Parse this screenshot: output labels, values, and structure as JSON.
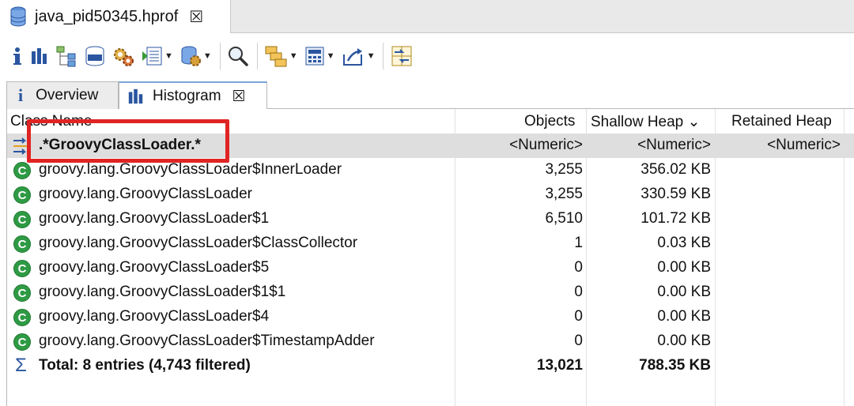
{
  "editor_tab": {
    "title": "java_pid50345.hprof",
    "close": "☒"
  },
  "inner_tabs": [
    {
      "label": "Overview"
    },
    {
      "label": "Histogram",
      "close": "☒"
    }
  ],
  "table": {
    "columns": {
      "class_name": "Class Name",
      "objects": "Objects",
      "shallow_heap": "Shallow Heap",
      "shallow_sort": "⌄",
      "retained_heap": "Retained Heap"
    },
    "filter": {
      "class_name": ".*GroovyClassLoader.*",
      "objects": "<Numeric>",
      "shallow_heap": "<Numeric>",
      "retained_heap": "<Numeric>"
    },
    "rows": [
      {
        "name": "groovy.lang.GroovyClassLoader$InnerLoader",
        "objects": "3,255",
        "shallow": "356.02 KB"
      },
      {
        "name": "groovy.lang.GroovyClassLoader",
        "objects": "3,255",
        "shallow": "330.59 KB"
      },
      {
        "name": "groovy.lang.GroovyClassLoader$1",
        "objects": "6,510",
        "shallow": "101.72 KB"
      },
      {
        "name": "groovy.lang.GroovyClassLoader$ClassCollector",
        "objects": "1",
        "shallow": "0.03 KB"
      },
      {
        "name": "groovy.lang.GroovyClassLoader$5",
        "objects": "0",
        "shallow": "0.00 KB"
      },
      {
        "name": "groovy.lang.GroovyClassLoader$1$1",
        "objects": "0",
        "shallow": "0.00 KB"
      },
      {
        "name": "groovy.lang.GroovyClassLoader$4",
        "objects": "0",
        "shallow": "0.00 KB"
      },
      {
        "name": "groovy.lang.GroovyClassLoader$TimestampAdder",
        "objects": "0",
        "shallow": "0.00 KB"
      }
    ],
    "total": {
      "label": "Total: 8 entries (4,743 filtered)",
      "objects": "13,021",
      "shallow": "788.35 KB"
    },
    "class_icon_letter": "C"
  },
  "colors": {
    "class_icon": "#2f9a44",
    "highlight": "#e02424",
    "accent_blue": "#2a55a0"
  }
}
